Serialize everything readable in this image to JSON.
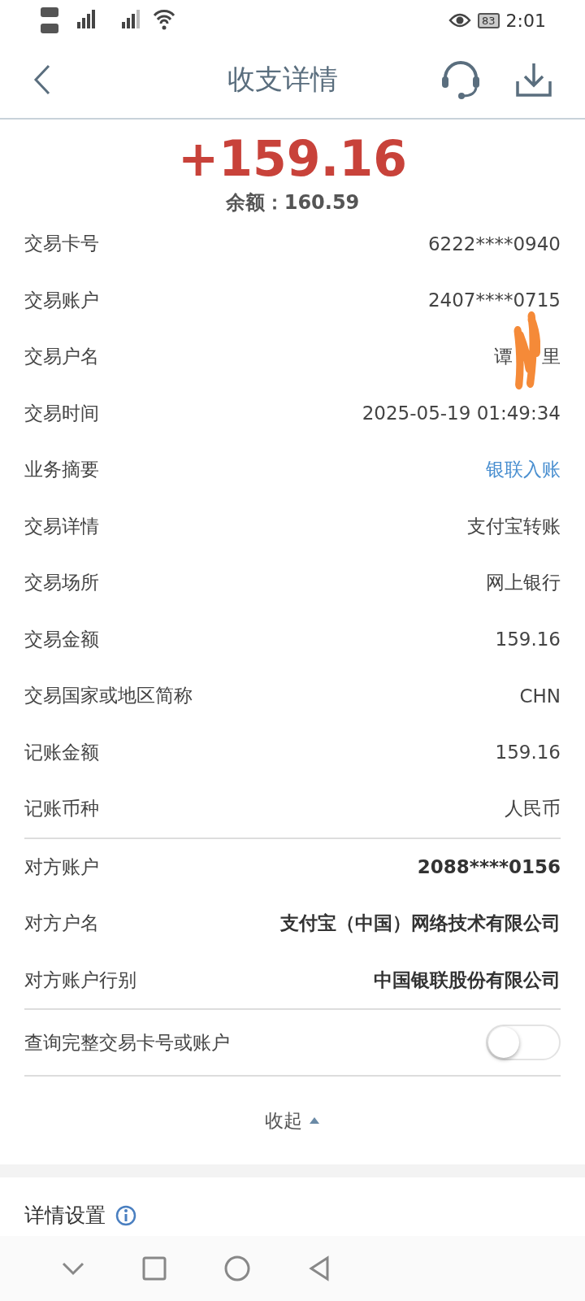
{
  "status_bar": {
    "battery": "83",
    "time": "2:01"
  },
  "header": {
    "title": "收支详情"
  },
  "summary": {
    "amount": "+159.16",
    "balance": "余额：160.59"
  },
  "details": [
    {
      "kind": "plain",
      "label": "交易卡号",
      "value": "6222****0940"
    },
    {
      "kind": "plain",
      "label": "交易账户",
      "value": "2407****0715"
    },
    {
      "kind": "redacted",
      "label": "交易户名",
      "value": "谭",
      "value_end": "里"
    },
    {
      "kind": "plain",
      "label": "交易时间",
      "value": "2025-05-19 01:49:34"
    },
    {
      "kind": "link",
      "label": "业务摘要",
      "value": "银联入账"
    },
    {
      "kind": "plain",
      "label": "交易详情",
      "value": "支付宝转账"
    },
    {
      "kind": "plain",
      "label": "交易场所",
      "value": "网上银行"
    },
    {
      "kind": "plain",
      "label": "交易金额",
      "value": "159.16"
    },
    {
      "kind": "plain",
      "label": "交易国家或地区简称",
      "value": "CHN"
    },
    {
      "kind": "plain",
      "label": "记账金额",
      "value": "159.16"
    },
    {
      "kind": "plain",
      "label": "记账币种",
      "value": "人民币"
    }
  ],
  "counterparty": [
    {
      "label": "对方账户",
      "value": "2088****0156"
    },
    {
      "label": "对方户名",
      "value": "支付宝（中国）网络技术有限公司"
    },
    {
      "label": "对方账户行别",
      "value": "中国银联股份有限公司"
    }
  ],
  "full_number_toggle": {
    "label": "查询完整交易卡号或账户",
    "on": false
  },
  "collapse": {
    "label": "收起"
  },
  "settings": {
    "title": "详情设置"
  }
}
